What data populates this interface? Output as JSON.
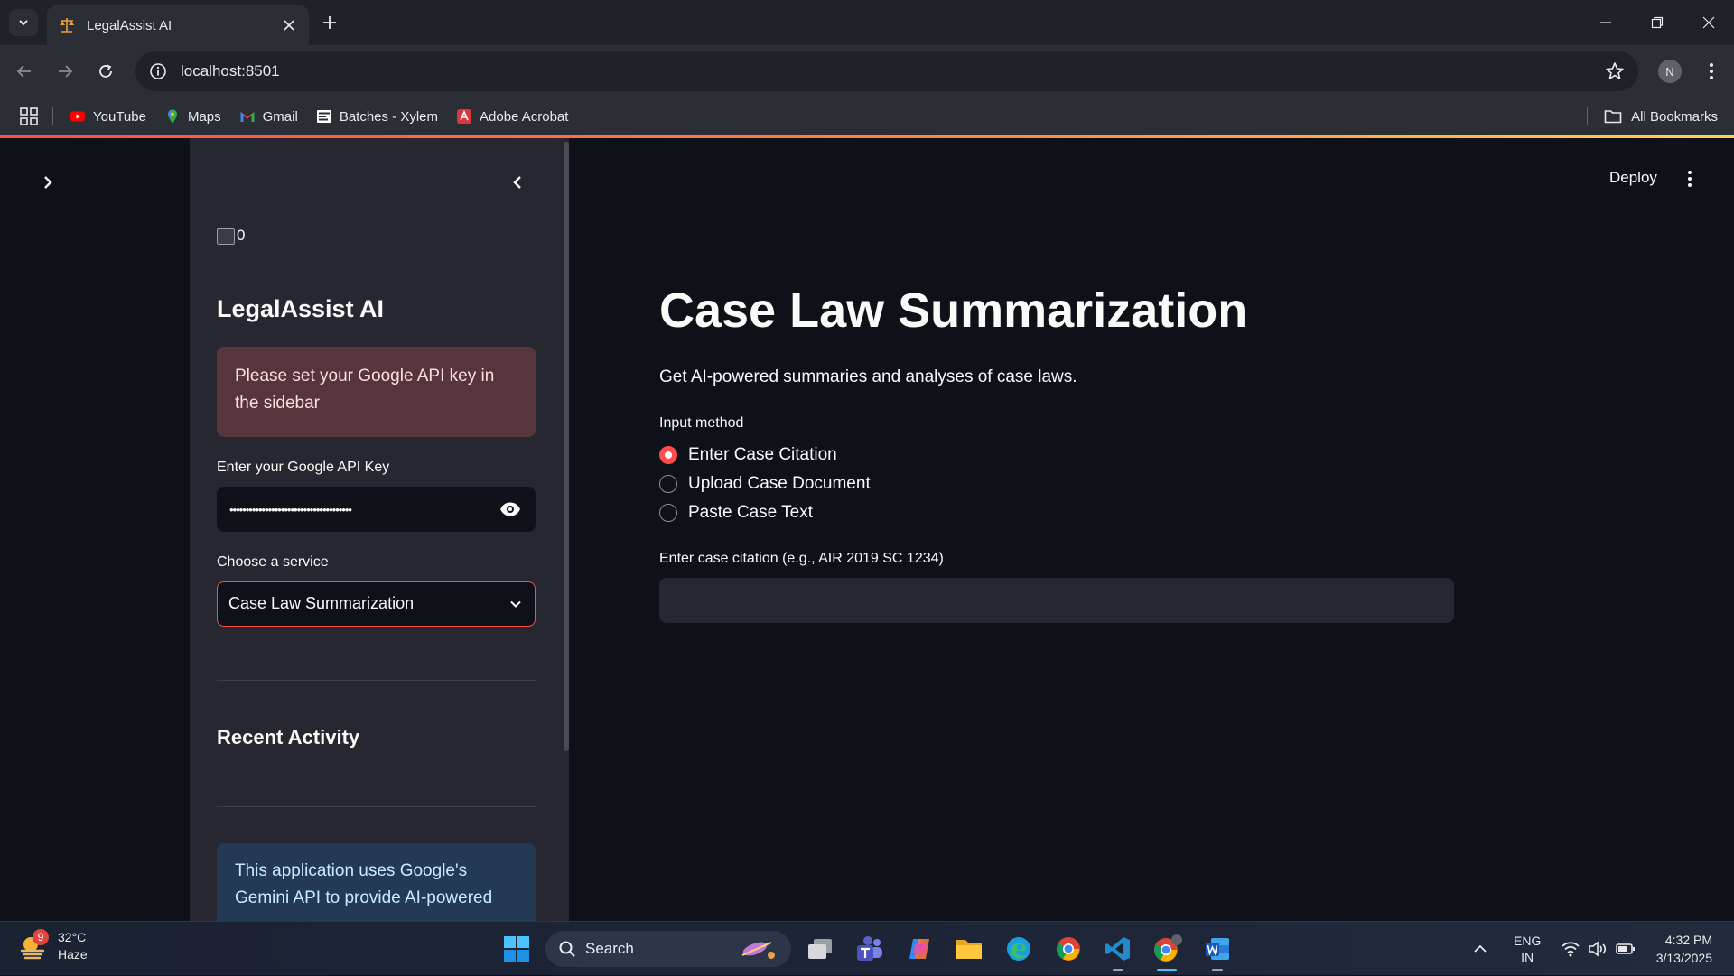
{
  "browser": {
    "tab_title": "LegalAssist AI",
    "url": "localhost:8501",
    "profile_initial": "N",
    "bookmarks": [
      {
        "label": "YouTube",
        "icon": "youtube-icon"
      },
      {
        "label": "Maps",
        "icon": "maps-icon"
      },
      {
        "label": "Gmail",
        "icon": "gmail-icon"
      },
      {
        "label": "Batches - Xylem",
        "icon": "xylem-icon"
      },
      {
        "label": "Adobe Acrobat",
        "icon": "acrobat-icon"
      }
    ],
    "all_bookmarks": "All Bookmarks"
  },
  "sidebar": {
    "logo_alt": "0",
    "title": "LegalAssist AI",
    "error_text": "Please set your Google API key in the sidebar",
    "api_key_label": "Enter your Google API Key",
    "api_key_value": "••••••••••••••••••••••••••••••••••••••",
    "service_label": "Choose a service",
    "service_value": "Case Law Summarization",
    "recent_activity": "Recent Activity",
    "info_text": "This application uses Google's Gemini API to provide AI-powered"
  },
  "header": {
    "deploy": "Deploy"
  },
  "main": {
    "title": "Case Law Summarization",
    "subtitle": "Get AI-powered summaries and analyses of case laws.",
    "input_method_label": "Input method",
    "options": [
      {
        "label": "Enter Case Citation",
        "selected": true
      },
      {
        "label": "Upload Case Document",
        "selected": false
      },
      {
        "label": "Paste Case Text",
        "selected": false
      }
    ],
    "citation_label": "Enter case citation (e.g., AIR 2019 SC 1234)",
    "citation_value": ""
  },
  "taskbar": {
    "weather_temp": "32°C",
    "weather_desc": "Haze",
    "weather_badge": "9",
    "search_label": "Search",
    "apps": [
      "task-view-icon",
      "teams-icon",
      "copilot-icon",
      "file-explorer-icon",
      "edge-icon",
      "chrome-icon",
      "vscode-icon",
      "chrome-profile-icon",
      "word-icon"
    ],
    "lang_line1": "ENG",
    "lang_line2": "IN",
    "time": "4:32 PM",
    "date": "3/13/2025"
  },
  "colors": {
    "accent": "#ff4b4b",
    "sidebar_bg": "#262730",
    "page_bg": "#0e1117"
  }
}
